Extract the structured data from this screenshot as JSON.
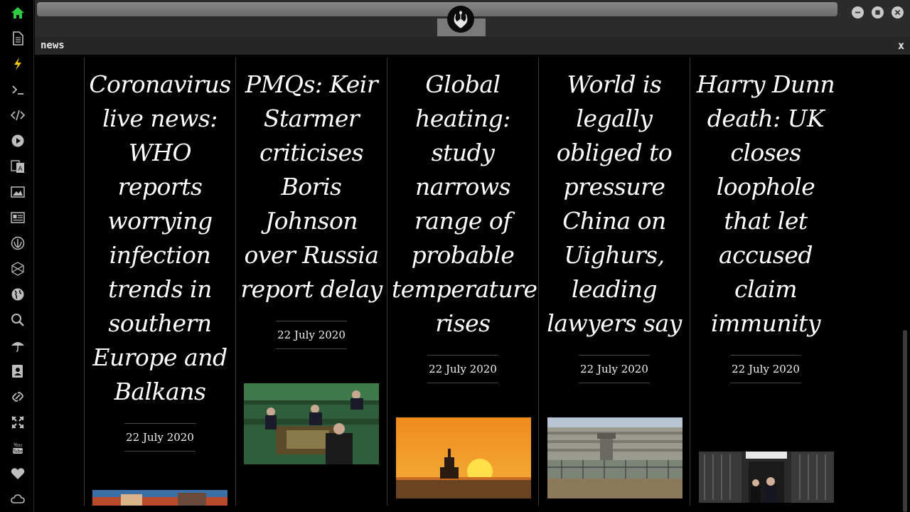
{
  "sidebar": {
    "items": [
      {
        "icon": "home-icon",
        "color": "#2ecc40"
      },
      {
        "icon": "document-icon"
      },
      {
        "icon": "bolt-icon",
        "color": "#f1c40f"
      },
      {
        "icon": "terminal-icon"
      },
      {
        "icon": "code-icon"
      },
      {
        "icon": "play-icon"
      },
      {
        "icon": "translate-icon"
      },
      {
        "icon": "image-icon"
      },
      {
        "icon": "newspaper-icon"
      },
      {
        "icon": "rebel-alliance-icon"
      },
      {
        "icon": "hexagon-network-icon"
      },
      {
        "icon": "globe-icon"
      },
      {
        "icon": "search-icon"
      },
      {
        "icon": "umbrella-icon"
      },
      {
        "icon": "contact-card-icon"
      },
      {
        "icon": "link-icon"
      },
      {
        "icon": "expand-arrows-icon"
      },
      {
        "icon": "youtube-icon"
      },
      {
        "icon": "heart-icon"
      },
      {
        "icon": "cloud-icon"
      }
    ]
  },
  "window": {
    "controls": [
      "minimize",
      "maximize",
      "close"
    ]
  },
  "panel": {
    "title": "news",
    "close_label": "x"
  },
  "articles": [
    {
      "headline": "Coronavirus live news: WHO reports worrying infection trends in southern Europe and Balkans",
      "date": "22 July 2020",
      "image": "street scene"
    },
    {
      "headline": "PMQs: Keir Starmer criticises Boris Johnson over Russia report delay",
      "date": "22 July 2020",
      "image": "House of Commons chamber"
    },
    {
      "headline": "Global heating: study narrows range of probable temperature rises",
      "date": "22 July 2020",
      "image": "sunset over sea with oil platform"
    },
    {
      "headline": "World is legally obliged to pressure China on Uighurs, leading lawyers say",
      "date": "22 July 2020",
      "image": "detention facility with watchtower"
    },
    {
      "headline": "Harry Dunn death: UK closes loophole that let accused claim immunity",
      "date": "22 July 2020",
      "image": "Downing Street door"
    }
  ]
}
